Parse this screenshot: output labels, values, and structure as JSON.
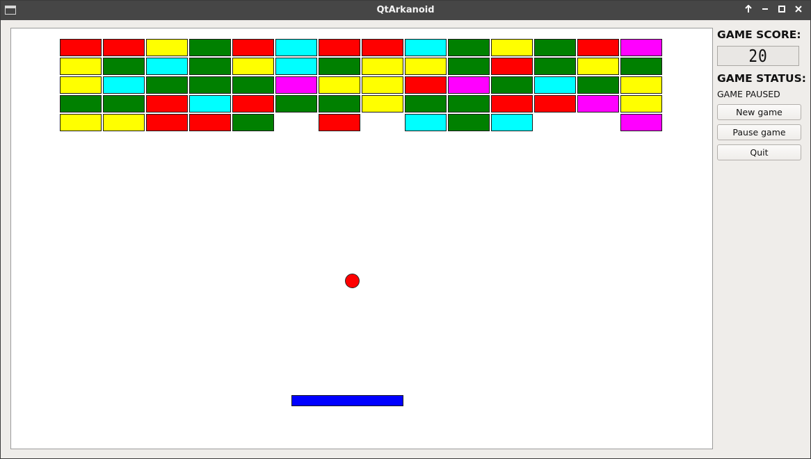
{
  "window": {
    "title": "QtArkanoid",
    "controls": [
      "up-arrow-icon",
      "minimize-icon",
      "maximize-icon",
      "close-icon"
    ]
  },
  "sidebar": {
    "score_heading": "GAME SCORE:",
    "score_value": "20",
    "status_heading": "GAME STATUS:",
    "status_value": "GAME PAUSED",
    "buttons": {
      "new_game": "New game",
      "pause_game": "Pause game",
      "quit": "Quit"
    }
  },
  "colors": {
    "red": "#ff0000",
    "yellow": "#ffff00",
    "green": "#008000",
    "cyan": "#00ffff",
    "magenta": "#ff00ff",
    "ball": "#ff0000",
    "paddle": "#0000ff",
    "field": "#ffffff"
  },
  "bricks": [
    [
      "red",
      "red",
      "yellow",
      "green",
      "red",
      "cyan",
      "red",
      "red",
      "cyan",
      "green",
      "yellow",
      "green",
      "red",
      "magenta"
    ],
    [
      "yellow",
      "green",
      "cyan",
      "green",
      "yellow",
      "cyan",
      "green",
      "yellow",
      "yellow",
      "green",
      "red",
      "green",
      "yellow",
      "green"
    ],
    [
      "yellow",
      "cyan",
      "green",
      "green",
      "green",
      "magenta",
      "yellow",
      "yellow",
      "red",
      "magenta",
      "green",
      "cyan",
      "green",
      "yellow"
    ],
    [
      "green",
      "green",
      "red",
      "cyan",
      "red",
      "green",
      "green",
      "yellow",
      "green",
      "green",
      "red",
      "red",
      "magenta",
      "yellow"
    ],
    [
      "yellow",
      "yellow",
      "red",
      "red",
      "green",
      null,
      "red",
      null,
      "cyan",
      "green",
      "cyan",
      null,
      null,
      "magenta"
    ]
  ]
}
